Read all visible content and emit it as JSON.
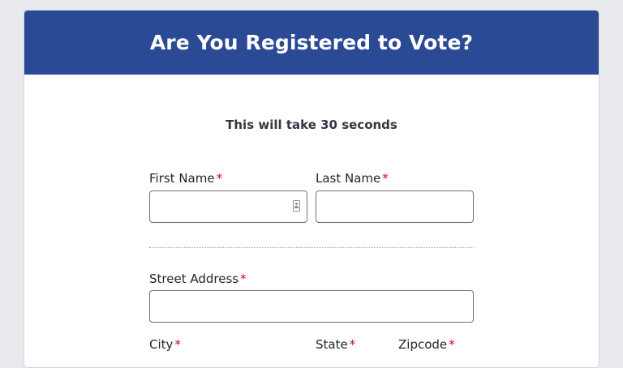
{
  "header": {
    "title": "Are You Registered to Vote?"
  },
  "intro": {
    "subtitle": "This will take 30 seconds"
  },
  "form": {
    "required_mark": "*",
    "first_name": {
      "label": "First Name",
      "value": ""
    },
    "last_name": {
      "label": "Last Name",
      "value": ""
    },
    "street_address": {
      "label": "Street Address",
      "value": ""
    },
    "city": {
      "label": "City"
    },
    "state": {
      "label": "State"
    },
    "zipcode": {
      "label": "Zipcode"
    }
  },
  "icons": {
    "autofill": "contact-card-icon"
  },
  "colors": {
    "header_background": "#2b4a96",
    "page_background": "#e9eaee",
    "required_asterisk": "#d0021b"
  }
}
